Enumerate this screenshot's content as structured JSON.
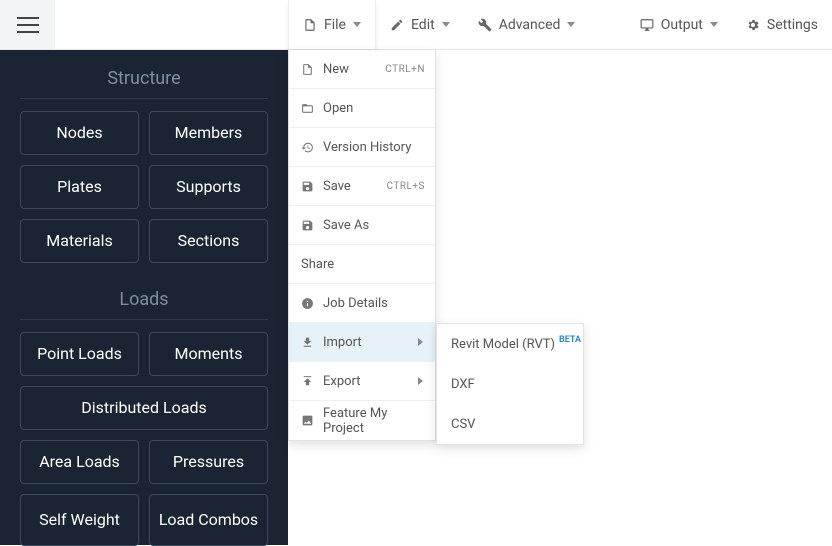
{
  "topmenu": {
    "file": "File",
    "edit": "Edit",
    "advanced": "Advanced",
    "output": "Output",
    "settings": "Settings"
  },
  "sidebar": {
    "structure": {
      "title": "Structure",
      "nodes": "Nodes",
      "members": "Members",
      "plates": "Plates",
      "supports": "Supports",
      "materials": "Materials",
      "sections": "Sections"
    },
    "loads": {
      "title": "Loads",
      "point_loads": "Point Loads",
      "moments": "Moments",
      "distributed_loads": "Distributed Loads",
      "area_loads": "Area Loads",
      "pressures": "Pressures",
      "self_weight": "Self Weight",
      "load_combos": "Load Combos"
    }
  },
  "file_menu": {
    "new": "New",
    "new_kbd": "CTRL+N",
    "open": "Open",
    "version_history": "Version History",
    "save": "Save",
    "save_kbd": "CTRL+S",
    "save_as": "Save As",
    "share": "Share",
    "job_details": "Job Details",
    "import": "Import",
    "export": "Export",
    "feature_my_project": "Feature My Project"
  },
  "import_submenu": {
    "revit": "Revit Model (RVT)",
    "revit_badge": "BETA",
    "dxf": "DXF",
    "csv": "CSV"
  }
}
